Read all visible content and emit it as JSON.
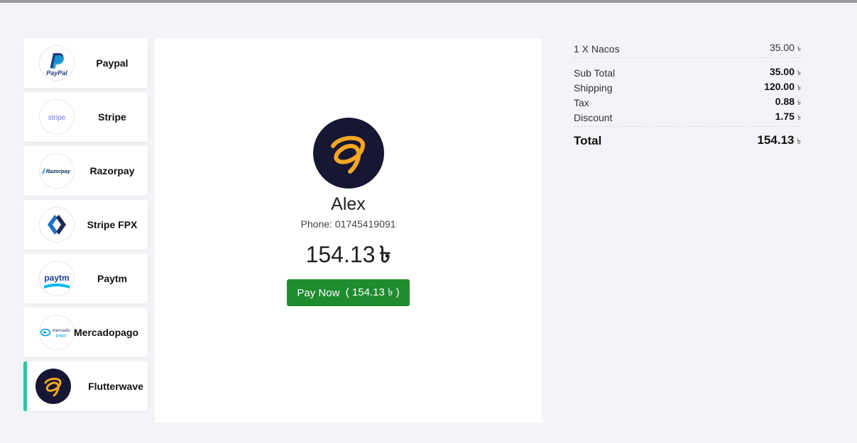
{
  "gateways": [
    {
      "name": "Paypal",
      "icon": "paypal-logo-icon",
      "active": false
    },
    {
      "name": "Stripe",
      "icon": "stripe-logo-icon",
      "active": false
    },
    {
      "name": "Razorpay",
      "icon": "razorpay-logo-icon",
      "active": false
    },
    {
      "name": "Stripe FPX",
      "icon": "stripe-fpx-logo-icon",
      "active": false
    },
    {
      "name": "Paytm",
      "icon": "paytm-logo-icon",
      "active": false
    },
    {
      "name": "Mercadopago",
      "icon": "mercadopago-logo-icon",
      "active": false
    },
    {
      "name": "Flutterwave",
      "icon": "flutterwave-logo-icon",
      "active": true
    }
  ],
  "logo_text": {
    "paypal": "PayPal",
    "stripe": "stripe",
    "razorpay": "Razorpay",
    "paytm": "paytm",
    "mercadopago_top": "mercado",
    "mercadopago_bottom": "pago"
  },
  "customer": {
    "name": "Alex",
    "phone": "Phone: 01745419091",
    "amount": "154.13",
    "currency_symbol": "৳"
  },
  "pay_button": {
    "label": "Pay Now",
    "amount_text": "( 154.13 ৳ )"
  },
  "summary": {
    "items": [
      {
        "label": "1 X Nacos",
        "value": "35.00",
        "currency": "৳"
      }
    ],
    "lines": [
      {
        "label": "Sub Total",
        "value": "35.00",
        "currency": "৳"
      },
      {
        "label": "Shipping",
        "value": "120.00",
        "currency": "৳"
      },
      {
        "label": "Tax",
        "value": "0.88",
        "currency": "৳"
      },
      {
        "label": "Discount",
        "value": "1.75",
        "currency": "৳"
      }
    ],
    "total": {
      "label": "Total",
      "value": "154.13",
      "currency": "৳"
    }
  },
  "colors": {
    "accent": "#2ec4a5",
    "pay_button": "#1f8b2f",
    "flutterwave_bg": "#171733",
    "flutterwave_gold": "#f5a623"
  }
}
